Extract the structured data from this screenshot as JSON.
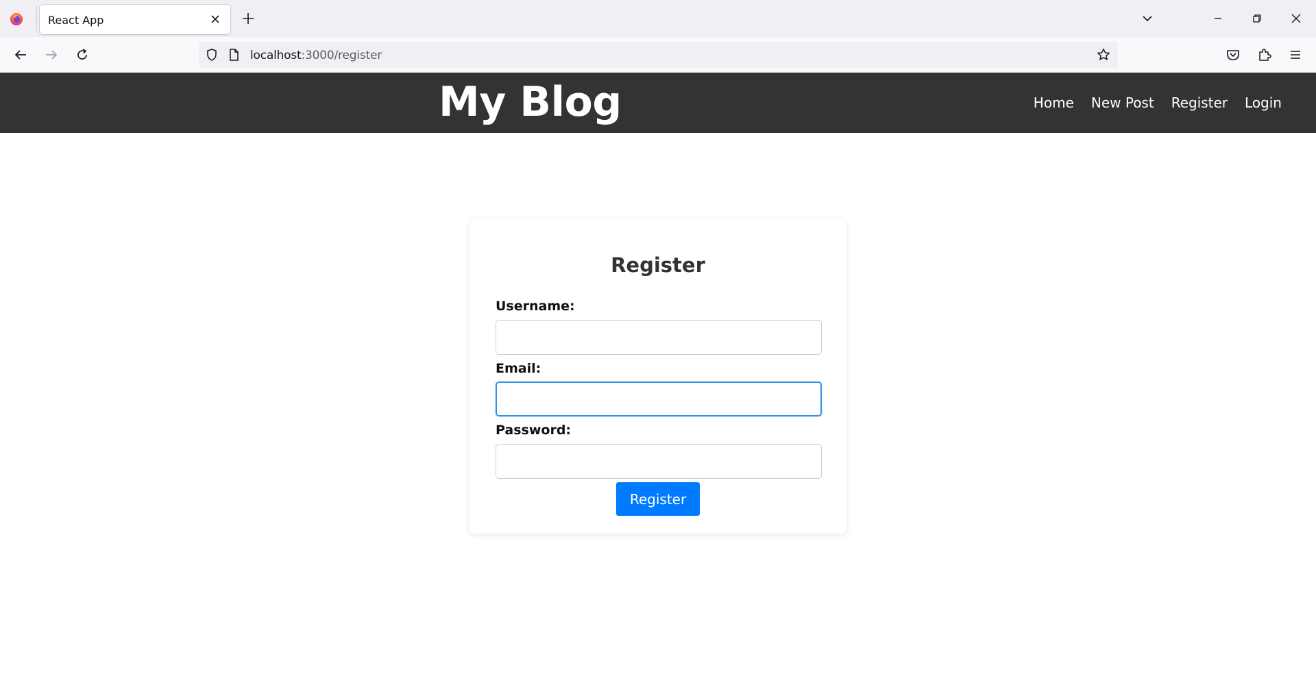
{
  "browser": {
    "tab_title": "React App",
    "url_host": "localhost",
    "url_rest": ":3000/register"
  },
  "header": {
    "site_title": "My Blog",
    "nav": [
      "Home",
      "New Post",
      "Register",
      "Login"
    ]
  },
  "form": {
    "title": "Register",
    "username_label": "Username:",
    "username_value": "",
    "email_label": "Email:",
    "email_value": "",
    "password_label": "Password:",
    "password_value": "",
    "submit_label": "Register"
  },
  "colors": {
    "header_bg": "#333333",
    "button_bg": "#007bff",
    "focus_border": "#3b8fe0"
  }
}
